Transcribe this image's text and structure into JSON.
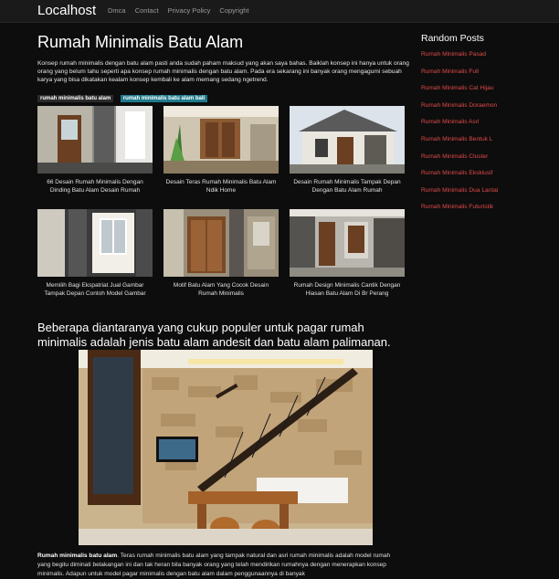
{
  "nav": {
    "brand": "Localhost",
    "links": [
      "Dmca",
      "Contact",
      "Privacy Policy",
      "Copyright"
    ]
  },
  "article": {
    "title": "Rumah Minimalis Batu Alam",
    "intro": "Konsep rumah minimalis dengan batu alam pasti anda sudah paham maksud yang akan saya bahas. Baiklah konsep ini hanya untuk orang orang yang belum tahu seperti apa konsep rumah minimalis dengan batu alam. Pada era sekarang ini banyak orang mengagumi sebuah karya yang bisa dikatakan kealam konsep kembali ke alam memang sedang ngetrend.",
    "tags": [
      "rumah minimalis batu alam",
      "rumah minimalis batu alam bali"
    ],
    "gallery": [
      "66 Desain Rumah Minimalis Dengan Dinding Batu Alam Desain Rumah",
      "Desain Teras Rumah Minimalis Batu Alam Ndik Home",
      "Desain Rumah Minimalis Tampak Depan Dengan Batu Alam Rumah",
      "Memilih Bagi Ekspatriat Jual Gambar Tampak Depan Contoh Model Gambar",
      "Motif Batu Alam Yang Cocok Desain Rumah Minimalis",
      "Rumah Design Minimalis Cantik Dengan Hiasan Batu Alam Di Br Perang"
    ],
    "section_heading": "Beberapa diantaranya yang cukup populer untuk pagar rumah minimalis adalah jenis batu alam andesit dan batu alam palimanan.",
    "bottom_bold": "Rumah minimalis batu alam",
    "bottom_text": ". Teras rumah minimalis batu alam yang tampak natural dan asri rumah minimalis adalah model rumah yang begitu diminati belakangan ini dan tak heran bila banyak orang yang telah mendirikan rumahnya dengan menerapkan konsep minimalis. Adapun untuk model pagar minimalis dengan batu alam dalam penggunaannya di banyak"
  },
  "sidebar": {
    "title": "Random Posts",
    "posts": [
      "Rumah Minimalis Pasad",
      "Rumah Minimalis Full",
      "Rumah Minimalis Cat Hijau",
      "Rumah Minimalis Doraemon",
      "Rumah Minimalis Asri",
      "Rumah Minimalis Bentuk L",
      "Rumah Minimalis Cluster",
      "Rumah Minimalis Eksklusif",
      "Rumah Minimalis Dua Lantai",
      "Rumah Minimalis Futuristik"
    ]
  },
  "colors": {
    "background": "#0d0d0d",
    "link_red": "#e04a4a",
    "tag_highlight": "#1f7a8c"
  }
}
